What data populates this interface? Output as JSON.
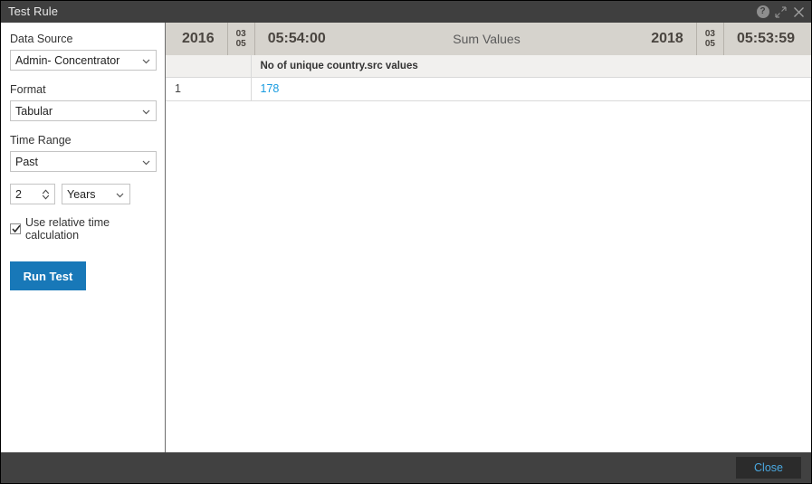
{
  "window": {
    "title": "Test Rule",
    "icons": {
      "help": "help-icon",
      "help_glyph": "?",
      "maximize": "expand-icon",
      "close": "close-icon"
    }
  },
  "sidebar": {
    "fields": [
      {
        "label": "Data Source",
        "value": "Admin- Concentrator",
        "control": "select"
      },
      {
        "label": "Format",
        "value": "Tabular",
        "control": "select"
      },
      {
        "label": "Time Range",
        "value": "Past",
        "control": "select"
      }
    ],
    "duration": {
      "amount": "2",
      "unit": "Years"
    },
    "relative_time": {
      "label": "Use relative time calculation",
      "checked": true
    },
    "run_button": "Run Test"
  },
  "results": {
    "header": {
      "start_year": "2016",
      "start_day": "03",
      "start_month": "05",
      "start_time": "05:54:00",
      "title": "Sum Values",
      "end_year": "2018",
      "end_day": "03",
      "end_month": "05",
      "end_time": "05:53:59"
    },
    "table": {
      "columns": [
        "",
        "No of unique country.src values"
      ],
      "rows": [
        {
          "index": "1",
          "value": "178"
        }
      ]
    }
  },
  "footer": {
    "close_label": "Close"
  },
  "colors": {
    "titlebar": "#3f3f3f",
    "footer": "#414141",
    "accent_button": "#1878b8",
    "link": "#1a9ce0",
    "header_bar": "#d6d3cd"
  }
}
